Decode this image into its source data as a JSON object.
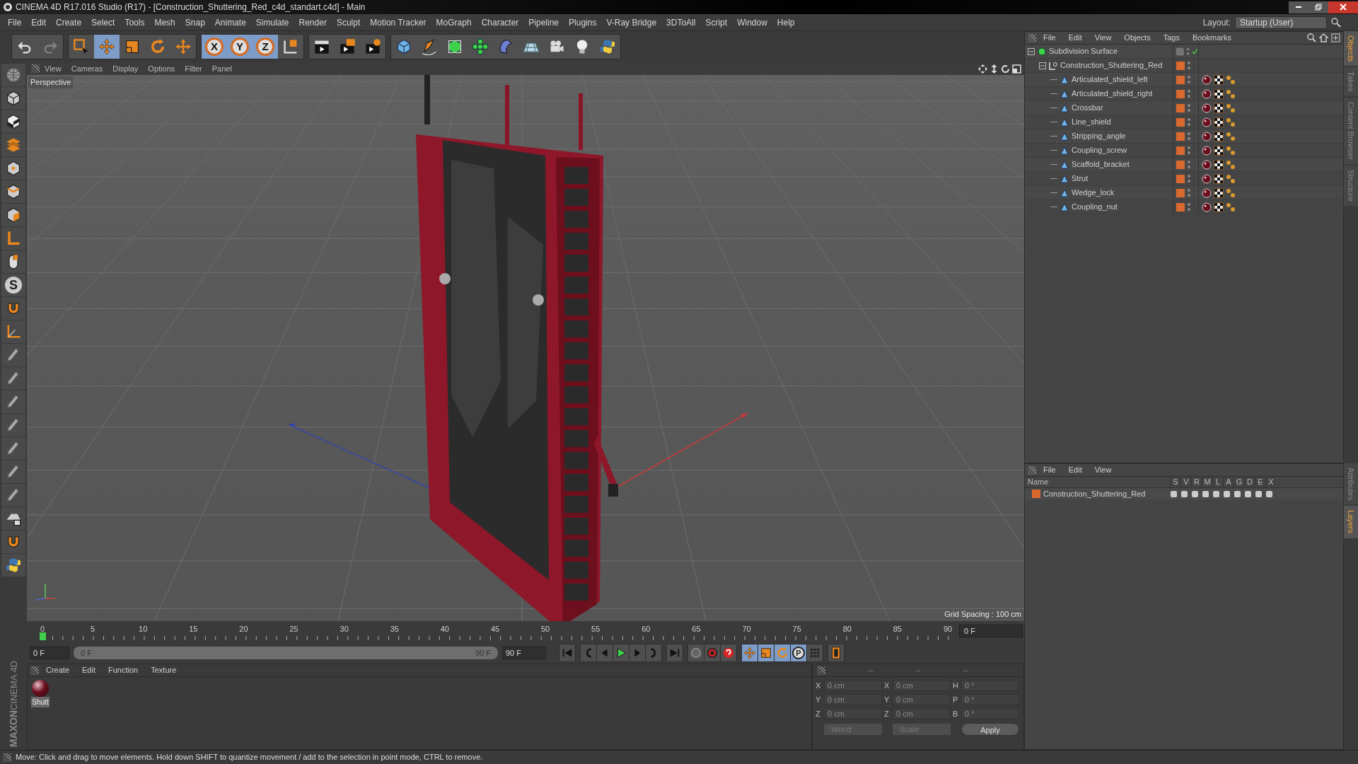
{
  "window": {
    "title": "CINEMA 4D R17.016 Studio (R17) - [Construction_Shuttering_Red_c4d_standart.c4d] - Main"
  },
  "menu_bar": [
    "File",
    "Edit",
    "Create",
    "Select",
    "Tools",
    "Mesh",
    "Snap",
    "Animate",
    "Simulate",
    "Render",
    "Sculpt",
    "Motion Tracker",
    "MoGraph",
    "Character",
    "Pipeline",
    "Plugins",
    "V-Ray Bridge",
    "3DToAll",
    "Script",
    "Window",
    "Help"
  ],
  "layout": {
    "label": "Layout:",
    "value": "Startup (User)"
  },
  "toolbar": [
    {
      "kind": "undo",
      "selected": false,
      "disabled": false
    },
    {
      "kind": "redo",
      "selected": false,
      "disabled": true
    },
    {
      "kind": "select",
      "selected": false,
      "disabled": false
    },
    {
      "kind": "move",
      "selected": true,
      "disabled": false
    },
    {
      "kind": "scale",
      "selected": false,
      "disabled": false
    },
    {
      "kind": "rotate",
      "selected": false,
      "disabled": false
    },
    {
      "kind": "recent",
      "selected": false,
      "disabled": false
    },
    {
      "kind": "axis",
      "label": "X",
      "selected": true,
      "disabled": false
    },
    {
      "kind": "axis",
      "label": "Y",
      "selected": true,
      "disabled": false
    },
    {
      "kind": "axis",
      "label": "Z",
      "selected": true,
      "disabled": false
    },
    {
      "kind": "coords",
      "selected": false,
      "disabled": false
    },
    {
      "kind": "render-view",
      "selected": false,
      "disabled": false
    },
    {
      "kind": "render-picture",
      "selected": false,
      "disabled": false
    },
    {
      "kind": "render-settings",
      "selected": false,
      "disabled": false
    },
    {
      "kind": "cube",
      "selected": false,
      "disabled": false
    },
    {
      "kind": "pen",
      "selected": false,
      "disabled": false
    },
    {
      "kind": "subdivision",
      "selected": false,
      "disabled": false
    },
    {
      "kind": "cloner",
      "selected": false,
      "disabled": false
    },
    {
      "kind": "bend",
      "selected": false,
      "disabled": false
    },
    {
      "kind": "floor",
      "selected": false,
      "disabled": false
    },
    {
      "kind": "camera",
      "selected": false,
      "disabled": false
    },
    {
      "kind": "light",
      "selected": false,
      "disabled": false
    },
    {
      "kind": "python",
      "selected": false,
      "disabled": false
    }
  ],
  "left_tools": [
    {
      "kind": "editable",
      "selected": false
    },
    {
      "kind": "model",
      "selected": false
    },
    {
      "kind": "texture",
      "selected": false
    },
    {
      "kind": "workplane",
      "selected": false
    },
    {
      "kind": "points",
      "selected": false
    },
    {
      "kind": "edges",
      "selected": false
    },
    {
      "kind": "polygons",
      "selected": false
    },
    {
      "kind": "axis-l",
      "selected": false
    },
    {
      "kind": "tweak",
      "selected": false
    },
    {
      "kind": "snap",
      "label": "S",
      "selected": false
    },
    {
      "kind": "magnet",
      "selected": false
    },
    {
      "kind": "workplane-axes",
      "selected": false
    },
    {
      "kind": "brush",
      "selected": false
    },
    {
      "kind": "brush",
      "selected": false
    },
    {
      "kind": "brush",
      "selected": false
    },
    {
      "kind": "brush",
      "selected": false
    },
    {
      "kind": "brush",
      "selected": false
    },
    {
      "kind": "brush",
      "selected": false
    },
    {
      "kind": "brush",
      "selected": false
    },
    {
      "kind": "grid-lock",
      "selected": false
    },
    {
      "kind": "magnet",
      "selected": false
    },
    {
      "kind": "python",
      "selected": false
    }
  ],
  "brand": [
    "MAXON",
    "CINEMA 4D"
  ],
  "viewport": {
    "menu": [
      "View",
      "Cameras",
      "Display",
      "Options",
      "Filter",
      "Panel"
    ],
    "camera_label": "Perspective",
    "grid_spacing": "Grid Spacing : 100 cm"
  },
  "timeline": {
    "ticks": [
      "0",
      "5",
      "10",
      "15",
      "20",
      "25",
      "30",
      "35",
      "40",
      "45",
      "50",
      "55",
      "60",
      "65",
      "70",
      "75",
      "80",
      "85",
      "90"
    ],
    "level": 0,
    "current_frame": "0 F"
  },
  "playback": {
    "start_field": "0 F",
    "range": {
      "start": "0 F",
      "end": "90 F",
      "level": 1
    },
    "end_field": "90 F",
    "buttons": [
      {
        "kind": "first",
        "selected": false
      },
      {
        "kind": "prev-key",
        "selected": false
      },
      {
        "kind": "prev",
        "selected": false
      },
      {
        "kind": "play",
        "selected": false
      },
      {
        "kind": "next",
        "selected": false
      },
      {
        "kind": "next-key",
        "selected": false
      },
      {
        "kind": "last",
        "selected": false
      },
      {
        "kind": "record",
        "selected": false
      },
      {
        "kind": "autokey",
        "selected": false
      },
      {
        "kind": "key-help",
        "selected": false
      },
      {
        "kind": "move",
        "selected": true
      },
      {
        "kind": "scale",
        "selected": true
      },
      {
        "kind": "rotate",
        "selected": true
      },
      {
        "kind": "param",
        "label": "P",
        "selected": true
      },
      {
        "kind": "dots",
        "selected": false
      },
      {
        "kind": "film",
        "selected": false
      }
    ]
  },
  "material_manager": {
    "menu": [
      "Create",
      "Edit",
      "Function",
      "Texture"
    ],
    "materials": [
      {
        "name": "Shutt",
        "selected": true
      }
    ]
  },
  "coordinates": {
    "headers": [
      "--",
      "--",
      "--"
    ],
    "rows": [
      {
        "fields": [
          {
            "label": "X",
            "value": "0 cm"
          },
          {
            "label": "X",
            "value": "0 cm"
          },
          {
            "label": "H",
            "value": "0 °"
          }
        ]
      },
      {
        "fields": [
          {
            "label": "Y",
            "value": "0 cm"
          },
          {
            "label": "Y",
            "value": "0 cm"
          },
          {
            "label": "P",
            "value": "0 °"
          }
        ]
      },
      {
        "fields": [
          {
            "label": "Z",
            "value": "0 cm"
          },
          {
            "label": "Z",
            "value": "0 cm"
          },
          {
            "label": "B",
            "value": "0 °"
          }
        ]
      }
    ],
    "dropdowns": [
      "World",
      "Scale"
    ],
    "apply": "Apply"
  },
  "object_manager": {
    "menu": [
      "File",
      "Edit",
      "View",
      "Objects",
      "Tags",
      "Bookmarks"
    ],
    "objects": [
      {
        "name": "Subdivision Surface",
        "kind": "generator",
        "expanded": true,
        "enabled": true,
        "children": [
          {
            "name": "Construction_Shuttering_Red",
            "kind": "null",
            "expanded": true,
            "color": "#d9692f",
            "children": [
              {
                "name": "Articulated_shield_left",
                "kind": "polygon",
                "color": "#d9692f"
              },
              {
                "name": "Articulated_shield_right",
                "kind": "polygon",
                "color": "#d9692f"
              },
              {
                "name": "Crossbar",
                "kind": "polygon",
                "color": "#d9692f"
              },
              {
                "name": "Line_shield",
                "kind": "polygon",
                "color": "#d9692f"
              },
              {
                "name": "Stripping_angle",
                "kind": "polygon",
                "color": "#d9692f"
              },
              {
                "name": "Coupling_screw",
                "kind": "polygon",
                "color": "#d9692f"
              },
              {
                "name": "Scaffold_bracket",
                "kind": "polygon",
                "color": "#d9692f"
              },
              {
                "name": "Strut",
                "kind": "polygon",
                "color": "#d9692f"
              },
              {
                "name": "Wedge_lock",
                "kind": "polygon",
                "color": "#d9692f"
              },
              {
                "name": "Coupling_nut",
                "kind": "polygon",
                "color": "#d9692f"
              }
            ]
          }
        ]
      }
    ]
  },
  "side_tabs_top": [
    {
      "label": "Objects",
      "selected": true
    },
    {
      "label": "Takes",
      "selected": false
    },
    {
      "label": "Content Browser",
      "selected": false
    },
    {
      "label": "Structure",
      "selected": false
    }
  ],
  "layer_manager": {
    "menu": [
      "File",
      "Edit",
      "View"
    ],
    "columns": [
      "Name",
      "S",
      "V",
      "R",
      "M",
      "L",
      "A",
      "G",
      "D",
      "E",
      "X"
    ],
    "layers": [
      {
        "name": "Construction_Shuttering_Red",
        "color": "#d9692f"
      }
    ]
  },
  "side_tabs_bottom": [
    {
      "label": "Attributes",
      "selected": false
    },
    {
      "label": "Layers",
      "selected": true
    }
  ],
  "status_bar": "Move: Click and drag to move elements. Hold down SHIFT to quantize movement / add to the selection in point mode, CTRL to remove."
}
